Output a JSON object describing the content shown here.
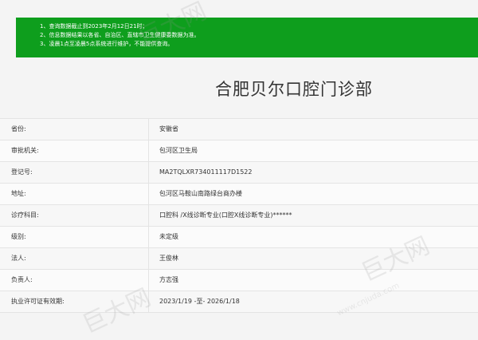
{
  "notice": {
    "lines": [
      "1、查询数据截止到2023年2月12日21时；",
      "2、信息数据结果以各省、自治区、直辖市卫生健康委数据为准。",
      "3、凌晨1点至凌晨5点系统进行维护，不能提供查询。"
    ]
  },
  "title": "合肥贝尔口腔门诊部",
  "rows": [
    {
      "label": "省份:",
      "value": "安徽省"
    },
    {
      "label": "审批机关:",
      "value": "包河区卫生局"
    },
    {
      "label": "登记号:",
      "value": "MA2TQLXR734011117D1522"
    },
    {
      "label": "地址:",
      "value": "包河区马鞍山南路绿台商办楼"
    },
    {
      "label": "诊疗科目:",
      "value": "口腔科 /X线诊断专业(口腔X线诊断专业)******"
    },
    {
      "label": "级别:",
      "value": "未定级"
    },
    {
      "label": "法人:",
      "value": "王俊林"
    },
    {
      "label": "负责人:",
      "value": "方志强"
    },
    {
      "label": "执业许可证有效期:",
      "value": "2023/1/19 -至- 2026/1/18"
    }
  ],
  "watermark": {
    "text": "巨大网",
    "domain": "www.cnjuda.com"
  }
}
